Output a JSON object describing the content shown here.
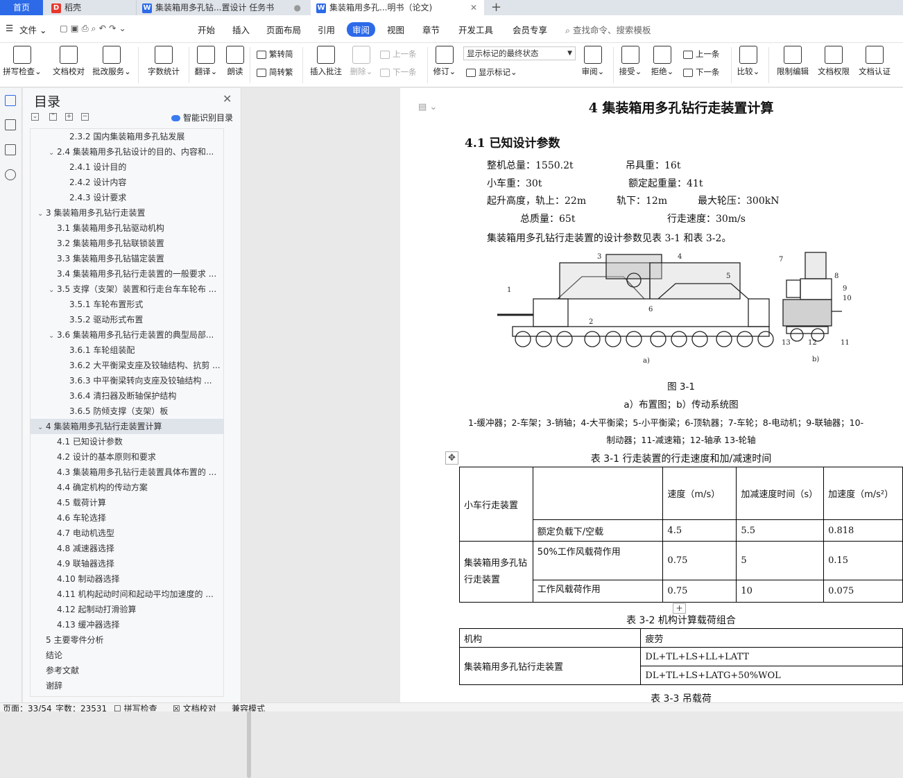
{
  "tabs": {
    "home": "首页",
    "daoke": "稻壳",
    "doc1": "集装箱用多孔钻...置设计 任务书",
    "doc2": "集装箱用多孔...明书（论文)",
    "close": "✕",
    "add": "+"
  },
  "menu": {
    "file": "文件",
    "items": [
      "开始",
      "插入",
      "页面布局",
      "引用",
      "审阅",
      "视图",
      "章节",
      "开发工具",
      "会员专享"
    ],
    "active_index": 4,
    "search": "查找命令、搜索模板"
  },
  "ribbon": {
    "spell": "拼写检查",
    "proof": "文档校对",
    "batch": "批改服务",
    "wordcount": "字数统计",
    "translate": "翻译",
    "read": "朗读",
    "t2s": "繁转简",
    "s2t": "简转繁",
    "insert_comment": "插入批注",
    "delete": "删除",
    "prev_comment": "上一条",
    "next_comment": "下一条",
    "revise": "修订",
    "markup_select": "显示标记的最终状态",
    "show_markup": "显示标记",
    "review": "审阅",
    "accept": "接受",
    "reject": "拒绝",
    "prev_change": "上一条",
    "next_change": "下一条",
    "compare": "比较",
    "restrict": "限制编辑",
    "rights": "文档权限",
    "certify": "文档认证"
  },
  "toc": {
    "title": "目录",
    "ai": "智能识别目录",
    "items": [
      {
        "level": 3,
        "text": "2.3.2  国内集装箱用多孔钻发展",
        "arrow": ""
      },
      {
        "level": 2,
        "text": "2.4  集装箱用多孔钻设计的目的、内容和...",
        "arrow": "⌄"
      },
      {
        "level": 3,
        "text": "2.4.1  设计目的",
        "arrow": ""
      },
      {
        "level": 3,
        "text": "2.4.2  设计内容",
        "arrow": ""
      },
      {
        "level": 3,
        "text": "2.4.3  设计要求",
        "arrow": ""
      },
      {
        "level": 1,
        "text": "3  集装箱用多孔钻行走装置",
        "arrow": "⌄"
      },
      {
        "level": 2,
        "text": "3.1  集装箱用多孔钻驱动机构",
        "arrow": ""
      },
      {
        "level": 2,
        "text": "3.2  集装箱用多孔钻联锁装置",
        "arrow": ""
      },
      {
        "level": 2,
        "text": "3.3  集装箱用多孔钻锚定装置",
        "arrow": ""
      },
      {
        "level": 2,
        "text": "3.4  集装箱用多孔钻行走装置的一般要求 ...",
        "arrow": ""
      },
      {
        "level": 2,
        "text": "3.5  支撑（支架）装置和行走台车车轮布 ...",
        "arrow": "⌄"
      },
      {
        "level": 3,
        "text": "3.5.1  车轮布置形式",
        "arrow": ""
      },
      {
        "level": 3,
        "text": "3.5.2  驱动形式布置",
        "arrow": ""
      },
      {
        "level": 2,
        "text": "3.6  集装箱用多孔钻行走装置的典型局部...",
        "arrow": "⌄"
      },
      {
        "level": 3,
        "text": "3.6.1  车轮组装配",
        "arrow": ""
      },
      {
        "level": 3,
        "text": "3.6.2  大平衡梁支座及铰轴结构、抗剪 ...",
        "arrow": ""
      },
      {
        "level": 3,
        "text": "3.6.3  中平衡梁转向支座及铰轴结构    ...",
        "arrow": ""
      },
      {
        "level": 3,
        "text": "3.6.4  清扫器及断轴保护结构",
        "arrow": ""
      },
      {
        "level": 3,
        "text": "3.6.5  防倾支撑（支架）板",
        "arrow": ""
      },
      {
        "level": 1,
        "text": "4  集装箱用多孔钻行走装置计算",
        "arrow": "⌄",
        "selected": true
      },
      {
        "level": 2,
        "text": "4.1 已知设计参数",
        "arrow": ""
      },
      {
        "level": 2,
        "text": "4.2  设计的基本原则和要求",
        "arrow": ""
      },
      {
        "level": 2,
        "text": "4.3  集装箱用多孔钻行走装置具体布置的 ...",
        "arrow": ""
      },
      {
        "level": 2,
        "text": "4.4  确定机构的传动方案",
        "arrow": ""
      },
      {
        "level": 2,
        "text": "4.5  载荷计算",
        "arrow": ""
      },
      {
        "level": 2,
        "text": "4.6  车轮选择",
        "arrow": ""
      },
      {
        "level": 2,
        "text": "4.7  电动机选型",
        "arrow": ""
      },
      {
        "level": 2,
        "text": "4.8  减速器选择",
        "arrow": ""
      },
      {
        "level": 2,
        "text": "4.9  联轴器选择",
        "arrow": ""
      },
      {
        "level": 2,
        "text": "4.10  制动器选择",
        "arrow": ""
      },
      {
        "level": 2,
        "text": "4.11  机构起动时间和起动平均加速度的 ...",
        "arrow": ""
      },
      {
        "level": 2,
        "text": "4.12  起制动打滑验算",
        "arrow": ""
      },
      {
        "level": 2,
        "text": "4.13  缓冲器选择",
        "arrow": ""
      },
      {
        "level": 1,
        "text": "5  主要零件分析",
        "arrow": ""
      },
      {
        "level": 0,
        "text": "结论",
        "arrow": ""
      },
      {
        "level": 0,
        "text": "参考文献",
        "arrow": ""
      },
      {
        "level": 0,
        "text": "谢辞",
        "arrow": ""
      }
    ]
  },
  "doc": {
    "h1": "4  集装箱用多孔钻行走装置计算",
    "h2": "4.1 已知设计参数",
    "p1a": "整机总量：1550.2t",
    "p1b": "吊具重：16t",
    "p2a": "小车重：30t",
    "p2b": "额定起重量：41t",
    "p3a": "起升高度，轨上：22m",
    "p3b": "轨下：12m",
    "p3c": "最大轮压：300kN",
    "p4a": "总质量：65t",
    "p4b": "行走速度：30m/s",
    "p5": "集装箱用多孔钻行走装置的设计参数见表  3-1  和表 3-2。",
    "fig_label_a": "a)",
    "fig_label_b": "b)",
    "fig_callouts": [
      "1",
      "2",
      "3",
      "4",
      "5",
      "6",
      "7",
      "8",
      "9",
      "10",
      "11",
      "12",
      "13"
    ],
    "fig_caption": "图 3-1",
    "fig_sub": "a）布置图；b）传动系统图",
    "fig_note1": "1-缓冲器；2-车架；3-销轴；4-大平衡梁；5-小平衡梁；6-顶轨器；7-车轮；8-电动机；9-联轴器；10-",
    "fig_note2": "制动器；11-减速箱；12-轴承 13-轮轴",
    "t1_caption": "表 3-1  行走装置的行走速度和加/减速时间",
    "t1": {
      "h_speed": "速度（m/s）",
      "h_time": "加减速度时间（s）",
      "h_acc": "加速度（m/s²）",
      "r_trolley": "小车行走装置",
      "r_trolley_sub": "额定负载下/空载",
      "v1": "4.5",
      "t1v": "5.5",
      "a1": "0.818",
      "r_gantry": "集装箱用多孔钻行走装置",
      "r_wind50": "50%工作风载荷作用",
      "v2": "0.75",
      "t2v": "5",
      "a2": "0.15",
      "r_wind": "工作风载荷作用",
      "v3": "0.75",
      "t3v": "10",
      "a3": "0.075"
    },
    "t2_caption": "表 3-2 机构计算载荷组合",
    "t2": {
      "h_mech": "机构",
      "h_fatigue": "疲劳",
      "r_mech": "集装箱用多孔钻行走装置",
      "c1": "DL+TL+LS+LL+LATT",
      "c2": "DL+TL+LS+LATG+50%WOL"
    },
    "t3_caption_partial": "表 3-3  吊载荷"
  },
  "status": {
    "page": "页面：33/54",
    "words": "字数：23531",
    "spell": "拼写检查",
    "proof": "文档校对",
    "compat": "兼容模式"
  }
}
